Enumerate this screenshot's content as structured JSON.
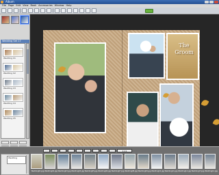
{
  "window": {
    "title": "Album"
  },
  "menu": [
    "File",
    "Page",
    "Edit",
    "View",
    "Book",
    "Accessories",
    "Window",
    "Help"
  ],
  "left_panel": {
    "header": "Wedding Set 17",
    "pages": [
      "Wedding 01",
      "Wedding 02",
      "Wedding 03",
      "Wedding 04",
      "Wedding 05"
    ]
  },
  "canvas": {
    "groom_text": "The\nGroom"
  },
  "bottom": {
    "selector": "1:11",
    "folder": "Wedding"
  },
  "filmstrip": [
    "Wedding01.jpg",
    "Wedding02.jpg",
    "Wedding03.jpg",
    "Wedding04.jpg",
    "Wedding05.jpg",
    "Wedding06.jpg",
    "Wedding07.jpg",
    "Wedding08.jpg",
    "Wedding09.jpg",
    "Wedding10.jpg",
    "Wedding11.jpg",
    "Wedding12.jpg",
    "Wedding13.jpg",
    "Wedding14.jpg",
    "Wedding15.jpg",
    "Wedding16.jpg",
    "Wedding17.jpg",
    "Wedding18.jpg"
  ]
}
